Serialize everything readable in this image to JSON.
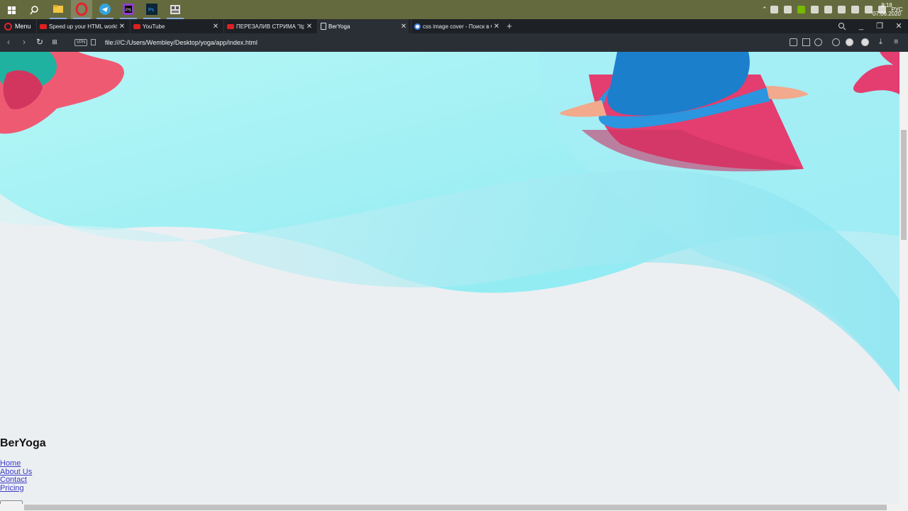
{
  "browser": {
    "menu_label": "Menu",
    "tabs": [
      {
        "title": "Speed up your HTML workflow"
      },
      {
        "title": "YouTube"
      },
      {
        "title": "ПЕРЕЗАЛИВ СТРИМА \"itproger"
      },
      {
        "title": "BerYoga"
      },
      {
        "title": "css image cover - Поиск в Google"
      }
    ],
    "active_tab": "BerYoga",
    "vpn_label": "VPN",
    "url": "file:///C:/Users/Wembley/Desktop/yoga/app/index.html"
  },
  "system": {
    "language": "РУС",
    "time": "8:18",
    "date": "07.06.2020"
  },
  "page": {
    "brand": "BerYoga",
    "nav": [
      "Home",
      "About Us",
      "Contact",
      "Pricing"
    ]
  },
  "colors": {
    "page_background": "#eceff2",
    "wave_cyan": "#9ef0f3",
    "mat_pink": "#e43d6f",
    "pants_blue": "#1b7fcc",
    "link": "#3d3dc7"
  }
}
